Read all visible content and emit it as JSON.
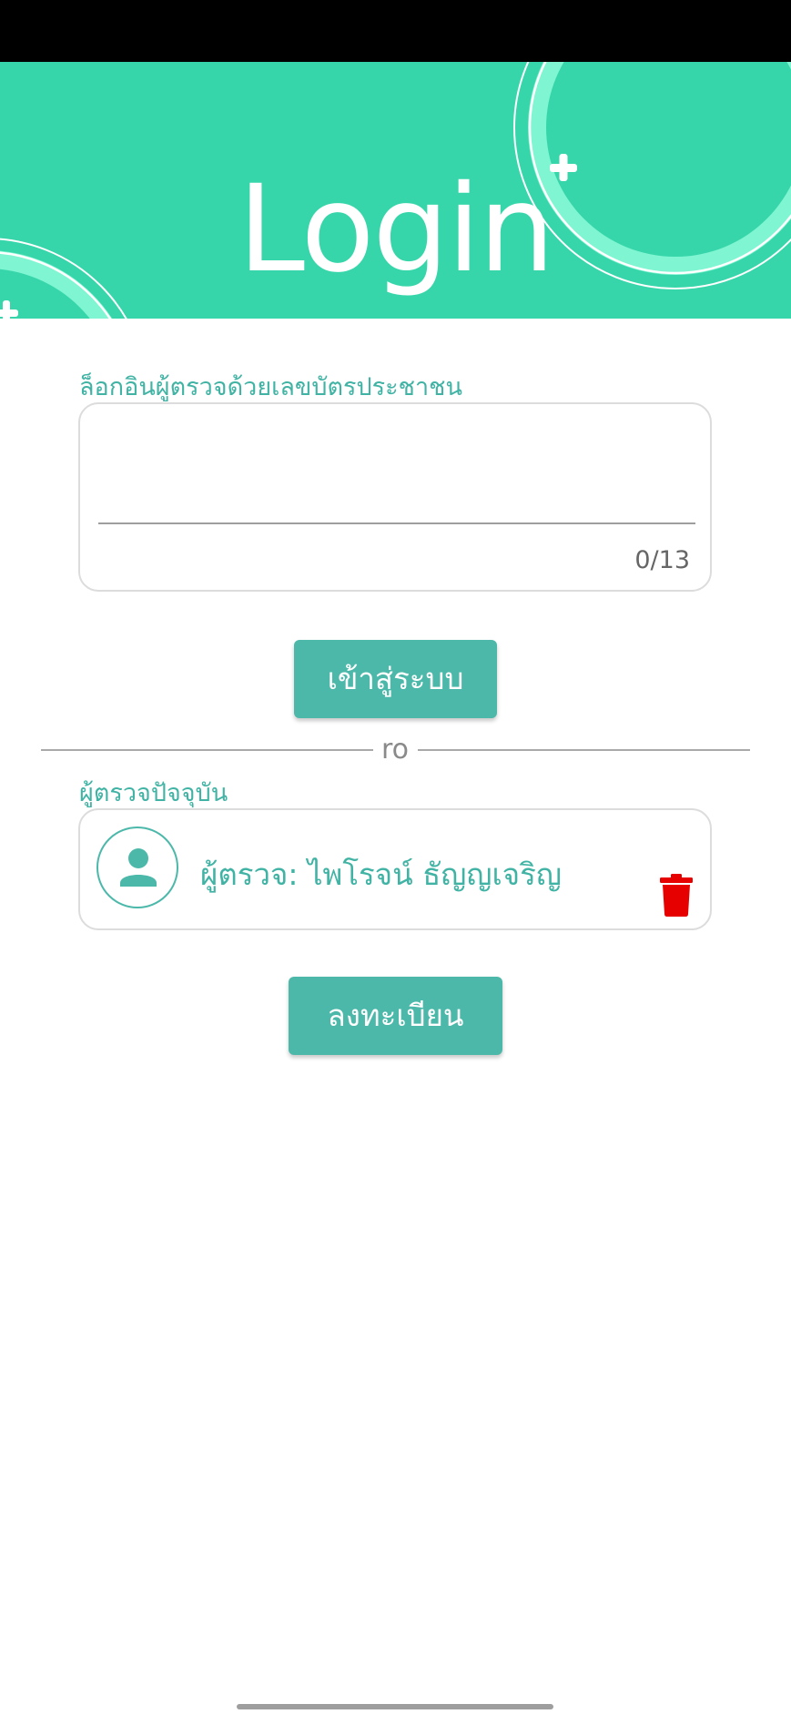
{
  "header": {
    "title": "Login"
  },
  "login_section": {
    "label": "ล็อกอินผู้ตรวจด้วยเลขบัตรประชาชน",
    "id_input_value": "",
    "char_counter": "0/13",
    "submit_label": "เข้าสู่ระบบ"
  },
  "divider": {
    "text": "ro"
  },
  "current_inspector": {
    "label": "ผู้ตรวจปัจจุบัน",
    "name": "ผู้ตรวจ: ไพโรจน์ ธัญญเจริญ",
    "avatar_icon": "person-icon",
    "delete_icon": "trash-icon"
  },
  "register": {
    "label": "ลงทะเบียน"
  },
  "colors": {
    "header_bg": "#36d6aa",
    "accent": "#4cb8aa",
    "label_text": "#40b3a4",
    "delete": "#e60000"
  }
}
